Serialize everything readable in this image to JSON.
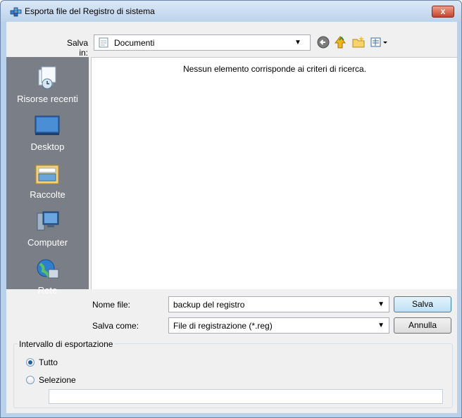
{
  "window": {
    "title": "Esporta file del Registro di sistema",
    "close_label": "x"
  },
  "toolbar": {
    "save_in_label": "Salva in:",
    "save_in_value": "Documenti",
    "icons": [
      "back-icon",
      "up-folder-icon",
      "new-folder-icon",
      "view-menu-icon"
    ]
  },
  "places": [
    {
      "label": "Risorse recenti",
      "icon": "recent-places-icon"
    },
    {
      "label": "Desktop",
      "icon": "desktop-icon"
    },
    {
      "label": "Raccolte",
      "icon": "libraries-icon"
    },
    {
      "label": "Computer",
      "icon": "computer-icon"
    },
    {
      "label": "Rete",
      "icon": "network-icon"
    }
  ],
  "file_list": {
    "empty_message": "Nessun elemento corrisponde ai criteri di ricerca."
  },
  "form": {
    "filename_label": "Nome file:",
    "filename_value": "backup del registro",
    "savetype_label": "Salva come:",
    "savetype_value": "File di registrazione (*.reg)",
    "save_button": "Salva",
    "cancel_button": "Annulla"
  },
  "export_range": {
    "legend": "Intervallo di esportazione",
    "option_all": "Tutto",
    "option_selection": "Selezione",
    "selected": "all",
    "selection_value": ""
  }
}
